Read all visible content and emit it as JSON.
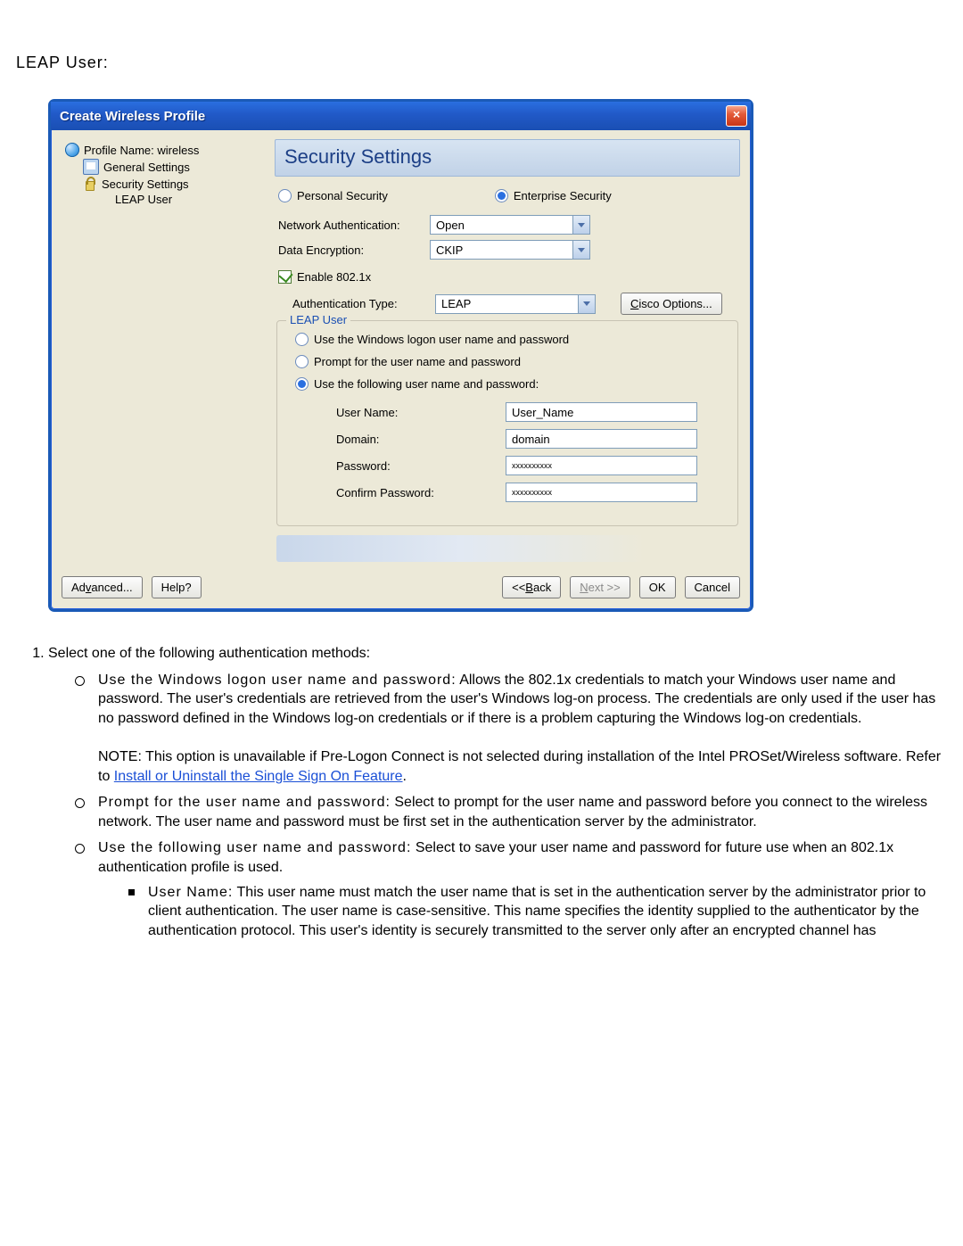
{
  "page": {
    "heading": "LEAP User:"
  },
  "dialog": {
    "title": "Create Wireless Profile",
    "close": "×",
    "tree": {
      "root": "Profile Name: wireless",
      "general": "General Settings",
      "security": "Security Settings",
      "leap": "LEAP User"
    },
    "panel": {
      "title": "Security Settings",
      "personal": "Personal Security",
      "enterprise": "Enterprise Security",
      "netAuthLabel": "Network Authentication:",
      "netAuthValue": "Open",
      "dataEncLabel": "Data Encryption:",
      "dataEncValue": "CKIP",
      "enable8021x": "Enable 802.1x",
      "authTypeLabel": "Authentication Type:",
      "authTypeValue": "LEAP",
      "ciscoOptions": "Cisco Options...",
      "fieldset": {
        "legend": "LEAP User",
        "optWindows": "Use the Windows logon user name and password",
        "optPrompt": "Prompt for the user name and password",
        "optFollowing": "Use the following user name and password:",
        "userNameLabel": "User Name:",
        "userNameValue": "User_Name",
        "domainLabel": "Domain:",
        "domainValue": "domain",
        "passwordLabel": "Password:",
        "passwordValue": "xxxxxxxxxx",
        "confirmLabel": "Confirm Password:",
        "confirmValue": "xxxxxxxxxx"
      }
    },
    "footer": {
      "advanced_pre": "Ad",
      "advanced_u": "v",
      "advanced_post": "anced...",
      "help": "Help?",
      "back_pre": "<< ",
      "back_u": "B",
      "back_post": "ack",
      "next_u": "N",
      "next_post": "ext >>",
      "ok": "OK",
      "cancel": "Cancel"
    }
  },
  "doc": {
    "item1": "Select one of the following authentication methods:",
    "b1_title": "Use the Windows logon user name and password:",
    "b1_text": " Allows the 802.1x credentials to match your Windows user name and password. The user's credentials are retrieved from the user's Windows log-on process. The credentials are only used if the user has no password defined in the Windows log-on credentials or if there is a problem capturing the Windows log-on credentials.",
    "b1_note_pre": "NOTE: This option is unavailable if Pre-Logon Connect is not selected during installation of the Intel PROSet/Wireless software. Refer to ",
    "b1_note_link": "Install or Uninstall the Single Sign On Feature",
    "b1_note_post": ".",
    "b2_title": "Prompt for the user name and password:",
    "b2_text": " Select to prompt for the user name and password before you connect to the wireless network. The user name and password must be first set in the authentication server by the administrator.",
    "b3_title": "Use the following user name and password:",
    "b3_text": " Select to save your user name and password for future use when an 802.1x authentication profile is used.",
    "b3a_title": "User Name:",
    "b3a_text": " This user name must match the user name that is set in the authentication server by the administrator prior to client authentication. The user name is case-sensitive. This name specifies the identity supplied to the authenticator by the authentication protocol. This user's identity is securely transmitted to the server only after an encrypted channel has"
  }
}
